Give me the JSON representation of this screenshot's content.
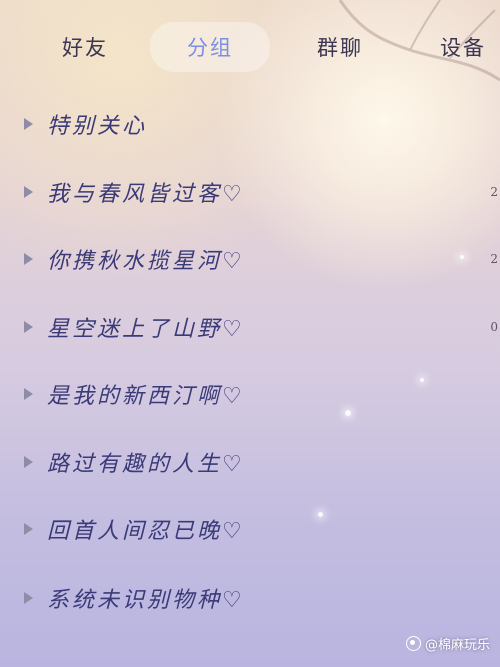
{
  "tabs": [
    {
      "label": "好友",
      "active": false
    },
    {
      "label": "分组",
      "active": true
    },
    {
      "label": "群聊",
      "active": false
    },
    {
      "label": "设备",
      "active": false
    }
  ],
  "groups": [
    {
      "label": "特别关心",
      "count": ""
    },
    {
      "label": "我与春风皆过客♡",
      "count": "2"
    },
    {
      "label": "你携秋水揽星河♡",
      "count": "2"
    },
    {
      "label": "星空迷上了山野♡",
      "count": "0"
    },
    {
      "label": "是我的新西汀啊♡",
      "count": ""
    },
    {
      "label": "路过有趣的人生♡",
      "count": ""
    },
    {
      "label": "回首人间忍已晚♡",
      "count": ""
    },
    {
      "label": "系统未识别物种♡",
      "count": ""
    }
  ],
  "watermark": {
    "text": "@棉麻玩乐",
    "icon": "weibo-logo-icon"
  },
  "colors": {
    "active_tab": "#7b8fe6",
    "label": "#3a3a78",
    "arrow": "#8f8ca8"
  }
}
